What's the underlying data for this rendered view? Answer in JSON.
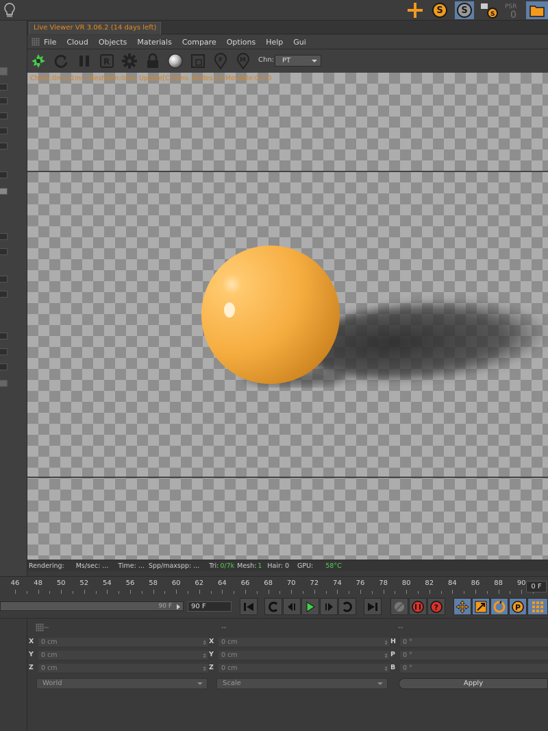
{
  "window": {
    "tab_title": "Live Viewer VR 3.06.2 (14 days left)"
  },
  "menu": [
    "File",
    "Cloud",
    "Objects",
    "Materials",
    "Compare",
    "Options",
    "Help",
    "Gui"
  ],
  "toolbar": {
    "channel_label": "Chn:",
    "channel_value": "PT",
    "icons": [
      "octane-icon",
      "restart-icon",
      "pause-icon",
      "region-icon",
      "settings-gear-icon",
      "lock-icon",
      "material-ball-icon",
      "zoom-frame-icon",
      "focus-pick-icon",
      "material-pick-icon"
    ]
  },
  "viewport": {
    "stats": "Check:0ms./1ms. MeshGen:0ms. Update[C]:0ms. Nodes:13 Movable:0  0 0",
    "sphere_color": "#f5b14a",
    "shadow_color": "#2f2f2f",
    "checker_dark": "#8e8e8e",
    "checker_light": "#adadad"
  },
  "status": {
    "rendering": "Rendering:",
    "ms_sec": "Ms/sec: ...",
    "time": "Time: ...",
    "spp": "Spp/maxspp: ...",
    "tri_label": "Tri:",
    "tri_value": "0/7k",
    "mesh_label": "Mesh:",
    "mesh_value": "1",
    "hair": "Hair: 0",
    "gpu_label": "GPU:",
    "gpu_temp": "58°C"
  },
  "timeline": {
    "ticks": [
      "46",
      "48",
      "50",
      "52",
      "54",
      "56",
      "58",
      "60",
      "62",
      "64",
      "66",
      "68",
      "70",
      "72",
      "74",
      "76",
      "78",
      "80",
      "82",
      "84",
      "86",
      "88",
      "90"
    ],
    "current_frame": "0 F"
  },
  "transport": {
    "range_end": "90 F",
    "frame_field": "90 F"
  },
  "attributes": {
    "col_headers": [
      "--",
      "--",
      "--"
    ],
    "position": [
      {
        "label": "X",
        "value": "0 cm"
      },
      {
        "label": "Y",
        "value": "0 cm"
      },
      {
        "label": "Z",
        "value": "0 cm"
      }
    ],
    "size": [
      {
        "label": "X",
        "value": "0 cm"
      },
      {
        "label": "Y",
        "value": "0 cm"
      },
      {
        "label": "Z",
        "value": "0 cm"
      }
    ],
    "rotation": [
      {
        "label": "H",
        "value": "0 °"
      },
      {
        "label": "P",
        "value": "0 °"
      },
      {
        "label": "B",
        "value": "0 °"
      }
    ],
    "coord_mode": "World",
    "size_mode": "Scale",
    "apply_label": "Apply"
  },
  "colors": {
    "accent_orange": "#e88a1a",
    "gpu_green": "#4fd14f"
  }
}
